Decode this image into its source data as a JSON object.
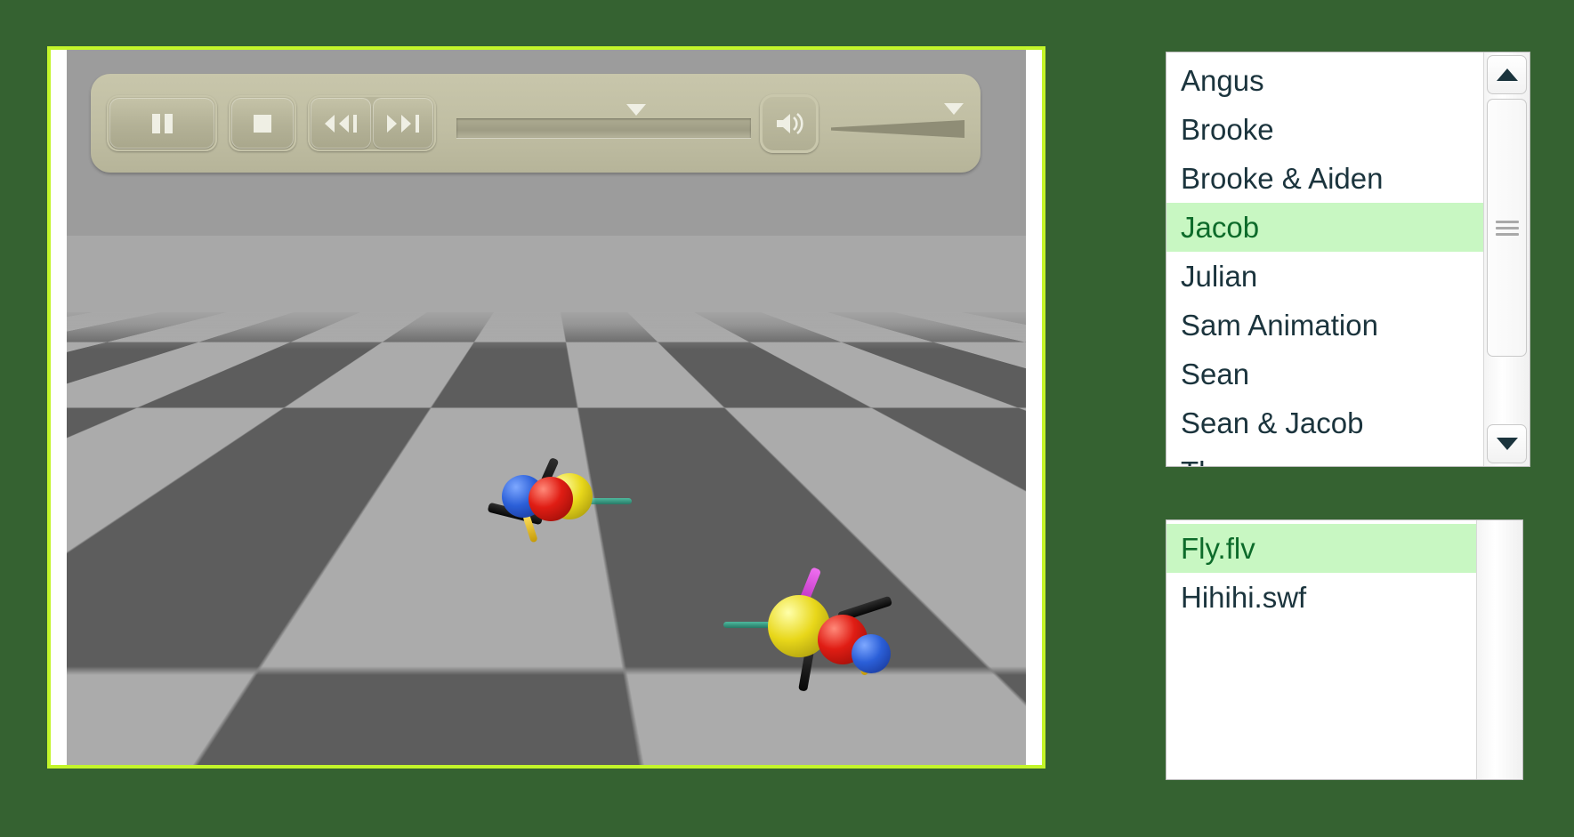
{
  "theme": {
    "page_background": "#356231",
    "player_border": "#c3f52a",
    "selection_background": "#c8f7c2",
    "selection_text": "#0d6b2a",
    "list_text": "#1b343d",
    "control_bar": "#c0bea3"
  },
  "player": {
    "controls": {
      "pause_label": "Pause",
      "stop_label": "Stop",
      "rewind_label": "Rewind",
      "fast_forward_label": "Fast Forward",
      "volume_label": "Volume",
      "seek_label": "Seek",
      "seek_position_percent": 61,
      "volume_position_percent": 92,
      "icons": {
        "pause": "pause-icon",
        "stop": "stop-icon",
        "rewind": "rewind-icon",
        "fast_forward": "fast-forward-icon",
        "volume": "speaker-icon",
        "seek_marker": "triangle-down-icon",
        "volume_marker": "triangle-down-icon"
      }
    },
    "scene": {
      "description": "3D checkerboard floor with two ball-and-stick figures",
      "floor_light": "#ababab",
      "floor_dark": "#5d5d5d",
      "sky": "#a8a8a8",
      "figures": [
        {
          "name": "figure-left",
          "balls": [
            "blue",
            "red",
            "yellow"
          ],
          "rods": [
            "black",
            "black",
            "teal",
            "gold"
          ]
        },
        {
          "name": "figure-right",
          "balls": [
            "yellow",
            "red",
            "blue"
          ],
          "rods": [
            "magenta",
            "black",
            "black",
            "teal",
            "gold"
          ]
        }
      ]
    }
  },
  "names_list": {
    "name": "animation-names-list",
    "selected_index": 3,
    "items": [
      {
        "label": "Angus"
      },
      {
        "label": "Brooke"
      },
      {
        "label": "Brooke & Aiden"
      },
      {
        "label": "Jacob"
      },
      {
        "label": "Julian"
      },
      {
        "label": "Sam Animation"
      },
      {
        "label": "Sean"
      },
      {
        "label": "Sean & Jacob"
      },
      {
        "label": "Thomas"
      }
    ],
    "scrollbar": {
      "up_label": "Scroll up",
      "down_label": "Scroll down",
      "thumb_label": "Scroll thumb"
    }
  },
  "files_list": {
    "name": "media-files-list",
    "selected_index": 0,
    "items": [
      {
        "label": "Fly.flv"
      },
      {
        "label": "Hihihi.swf"
      }
    ]
  }
}
